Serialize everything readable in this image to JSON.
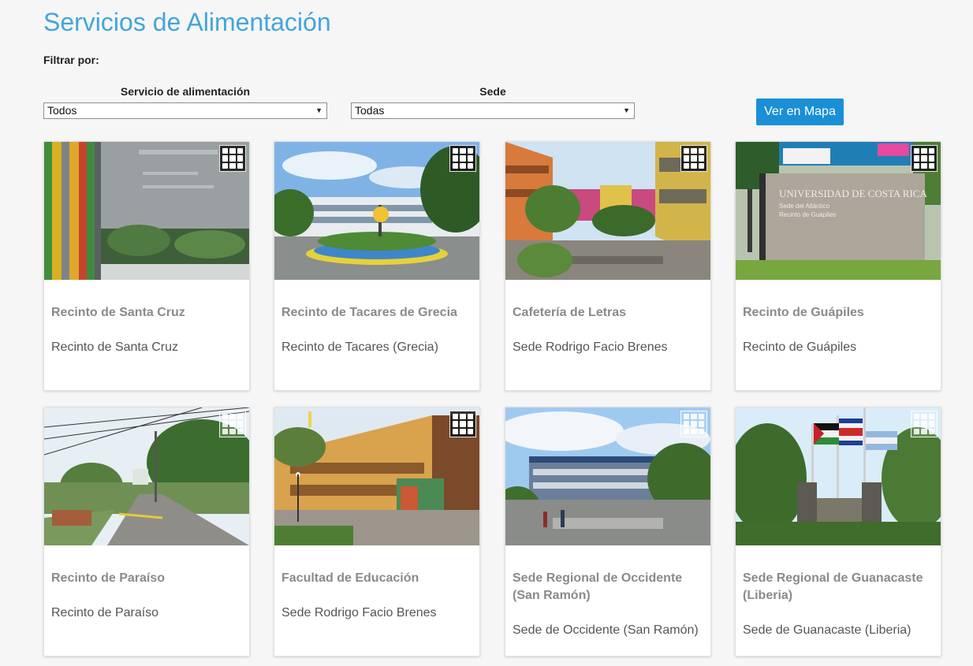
{
  "page": {
    "title": "Servicios de Alimentación"
  },
  "filters": {
    "label": "Filtrar por:",
    "service": {
      "label": "Servicio de alimentación",
      "selected": "Todos"
    },
    "campus": {
      "label": "Sede",
      "selected": "Todas"
    },
    "map_button": "Ver en Mapa"
  },
  "icons": {
    "grid": "grid-view-icon",
    "dropdown": "triangle-down-icon"
  },
  "colors": {
    "title": "#43a5dd",
    "button": "#1a8fd6"
  },
  "cards": [
    {
      "title": "Recinto de Santa Cruz",
      "subtitle": "Recinto de Santa Cruz"
    },
    {
      "title": "Recinto de Tacares de Grecia",
      "subtitle": "Recinto de Tacares (Grecia)"
    },
    {
      "title": "Cafetería de Letras",
      "subtitle": "Sede Rodrigo Facio Brenes"
    },
    {
      "title": "Recinto de Guápiles",
      "subtitle": "Recinto de Guápiles",
      "photo_text": [
        "UNIVERSIDAD DE COSTA RICA",
        "Sede del Atlántico",
        "Recinto de Guápiles"
      ]
    },
    {
      "title": "Recinto de Paraíso",
      "subtitle": "Recinto de Paraíso"
    },
    {
      "title": "Facultad de Educación",
      "subtitle": "Sede Rodrigo Facio Brenes"
    },
    {
      "title": "Sede Regional de Occidente (San Ramón)",
      "subtitle": "Sede de Occidente (San Ramón)"
    },
    {
      "title": "Sede Regional de Guanacaste (Liberia)",
      "subtitle": "Sede de Guanacaste (Liberia)"
    }
  ]
}
